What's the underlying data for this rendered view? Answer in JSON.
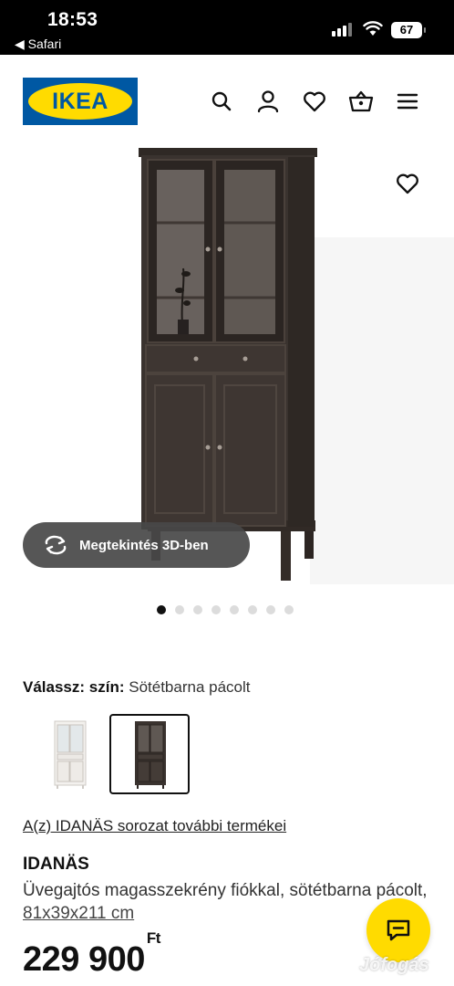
{
  "status_bar": {
    "time": "18:53",
    "back_label": "◀ Safari",
    "battery": "67"
  },
  "header": {
    "logo_text": "IKEA",
    "icons": [
      "search-icon",
      "account-icon",
      "favourites-icon",
      "cart-icon",
      "menu-icon"
    ]
  },
  "gallery": {
    "view3d_label": "Megtekintés 3D-ben",
    "image_count": 8,
    "active_index": 0
  },
  "color": {
    "label": "Válassz: szín:",
    "value": "Sötétbarna pácolt",
    "options": [
      "white-variant",
      "dark-brown-variant"
    ],
    "selected_index": 1
  },
  "series_link": "A(z) IDANÄS sorozat további termékei",
  "product": {
    "name": "IDANÄS",
    "description": "Üvegajtós magasszekrény fiókkal, sötétbarna pácolt,",
    "size": "81x39x211 cm",
    "price": "229 900",
    "currency": "Ft"
  },
  "watermark": "Jófogás",
  "colors": {
    "ikea_blue": "#0058a3",
    "ikea_yellow": "#ffdb00",
    "cabinet_brown": "#3a332f"
  }
}
